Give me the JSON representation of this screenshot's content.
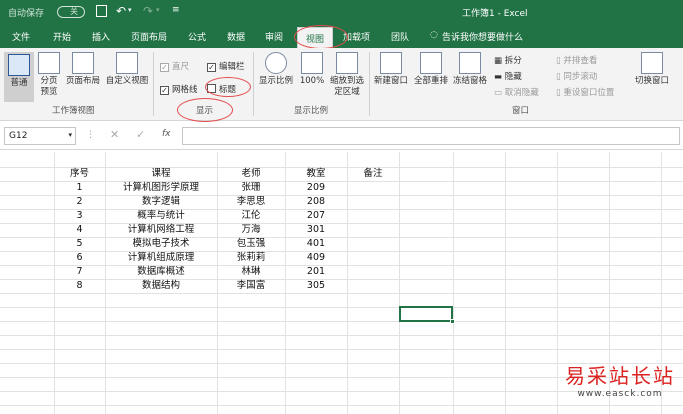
{
  "titlebar": {
    "autosave": "自动保存",
    "autosave_state": "关",
    "title": "工作簿1  -  Excel"
  },
  "tabs": [
    "文件",
    "开始",
    "插入",
    "页面布局",
    "公式",
    "数据",
    "审阅",
    "视图",
    "加载项",
    "团队"
  ],
  "tellme": "告诉我你想要做什么",
  "ribbon": {
    "wb_views": {
      "normal": "普通",
      "pagebreak": "分页预览",
      "pagelayout": "页面布局",
      "custom": "自定义视图",
      "group": "工作簿视图"
    },
    "show": {
      "ruler": "直尺",
      "formula_bar": "编辑栏",
      "gridlines": "网格线",
      "headings": "标题",
      "group": "显示"
    },
    "zoom": {
      "zoom": "显示比例",
      "z100": "100%",
      "zoom_sel": "缩放到选定区域",
      "group": "显示比例"
    },
    "window": {
      "new": "新建窗口",
      "arrange": "全部重排",
      "freeze": "冻结窗格",
      "split": "拆分",
      "hide": "隐藏",
      "unhide": "取消隐藏",
      "side": "并排查看",
      "sync": "同步滚动",
      "reset": "重设窗口位置",
      "switch": "切换窗口",
      "group": "窗口"
    }
  },
  "formula": {
    "namebox": "G12",
    "fx": "fx"
  },
  "table": {
    "headers": [
      "序号",
      "课程",
      "老师",
      "教室",
      "备注"
    ],
    "rows": [
      [
        "1",
        "计算机图形学原理",
        "张珊",
        "209"
      ],
      [
        "2",
        "数字逻辑",
        "李思思",
        "208"
      ],
      [
        "3",
        "概率与统计",
        "江伦",
        "207"
      ],
      [
        "4",
        "计算机网络工程",
        "万海",
        "301"
      ],
      [
        "5",
        "模拟电子技术",
        "包玉强",
        "401"
      ],
      [
        "6",
        "计算机组成原理",
        "张莉莉",
        "409"
      ],
      [
        "7",
        "数据库概述",
        "林琳",
        "201"
      ],
      [
        "8",
        "数据结构",
        "李国富",
        "305"
      ]
    ]
  },
  "watermark": {
    "cn": "易采站长站",
    "url": "www.easck.com"
  }
}
